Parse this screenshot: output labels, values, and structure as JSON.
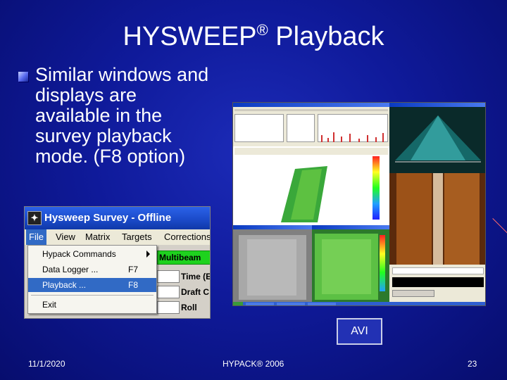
{
  "slide": {
    "title": "HYSWEEP",
    "title_mark": "®",
    "title_suffix": " Playback",
    "bullet": "Similar windows and displays are available in the survey playback mode. (F8 option)",
    "avi_label": "AVI",
    "footer_date": "11/1/2020",
    "footer_center": "HYPACK® 2006",
    "page_number": "23"
  },
  "survey_window": {
    "title": "Hysweep Survey - Offline",
    "menu": [
      "File",
      "View",
      "Matrix",
      "Targets",
      "Corrections"
    ],
    "active_menu": "File",
    "dropdown": [
      {
        "label": "Hypack Commands",
        "shortcut": "",
        "submenu": true
      },
      {
        "label": "Data Logger ...",
        "shortcut": "F7"
      },
      {
        "label": "Playback ...",
        "shortcut": "F8",
        "selected": true
      },
      {
        "label": "Exit",
        "shortcut": ""
      }
    ],
    "status_label": "Multibeam",
    "fields": [
      "Time (E",
      "Draft C",
      "Roll"
    ]
  },
  "colors": {
    "background": "#0f1a9a",
    "menu_selected": "#316ac5",
    "status_green": "#1ed21e"
  }
}
